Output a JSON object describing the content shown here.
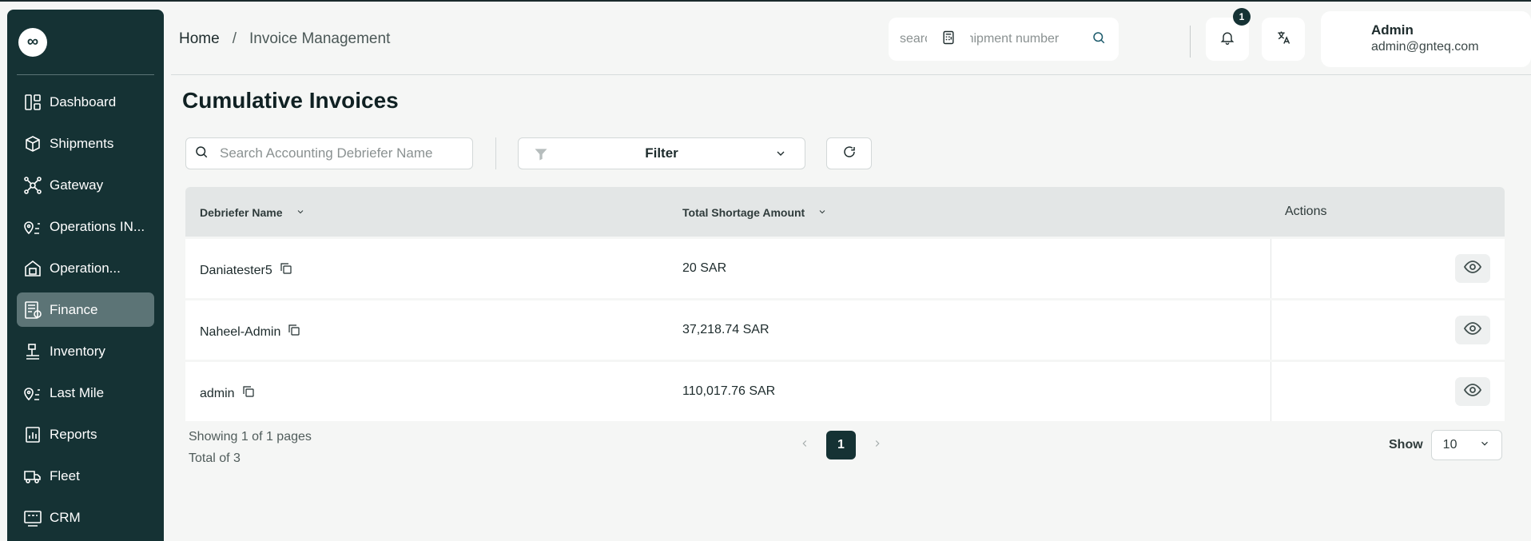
{
  "sidebar": {
    "logo": "∞",
    "items": [
      {
        "label": "Dashboard",
        "icon": "dashboard-icon",
        "active": false
      },
      {
        "label": "Shipments",
        "icon": "package-icon",
        "active": false
      },
      {
        "label": "Gateway",
        "icon": "network-icon",
        "active": false
      },
      {
        "label": "Operations IN...",
        "icon": "route-pin-icon",
        "active": false
      },
      {
        "label": "Operation...",
        "icon": "box-house-icon",
        "active": false
      },
      {
        "label": "Finance",
        "icon": "invoice-icon",
        "active": true
      },
      {
        "label": "Inventory",
        "icon": "forklift-icon",
        "active": false
      },
      {
        "label": "Last Mile",
        "icon": "route-pin-icon",
        "active": false
      },
      {
        "label": "Reports",
        "icon": "report-icon",
        "active": false
      },
      {
        "label": "Fleet",
        "icon": "truck-icon",
        "active": false
      },
      {
        "label": "CRM",
        "icon": "crm-icon",
        "active": false
      }
    ]
  },
  "header": {
    "breadcrumb": {
      "home": "Home",
      "separator": "/",
      "current": "Invoice Management"
    },
    "search_placeholder": "search for shipment number",
    "notification_count": "1",
    "user": {
      "name": "Admin",
      "email": "admin@gnteq.com"
    }
  },
  "main": {
    "title": "Cumulative Invoices",
    "search_placeholder": "Search Accounting Debriefer Name",
    "filter_label": "Filter",
    "columns": {
      "name": "Debriefer Name",
      "amount": "Total Shortage Amount",
      "actions": "Actions"
    },
    "rows": [
      {
        "name": "Daniatester5",
        "amount": "20 SAR"
      },
      {
        "name": "Naheel-Admin",
        "amount": "37,218.74 SAR"
      },
      {
        "name": "admin",
        "amount": "110,017.76 SAR"
      }
    ],
    "pagination": {
      "showing": "Showing 1 of 1 pages",
      "total": "Total of 3",
      "current_page": "1",
      "show_label": "Show",
      "page_size": "10"
    }
  },
  "colors": {
    "sidebar_bg": "#153234",
    "active_item": "#5c7476",
    "accent": "#153234"
  }
}
